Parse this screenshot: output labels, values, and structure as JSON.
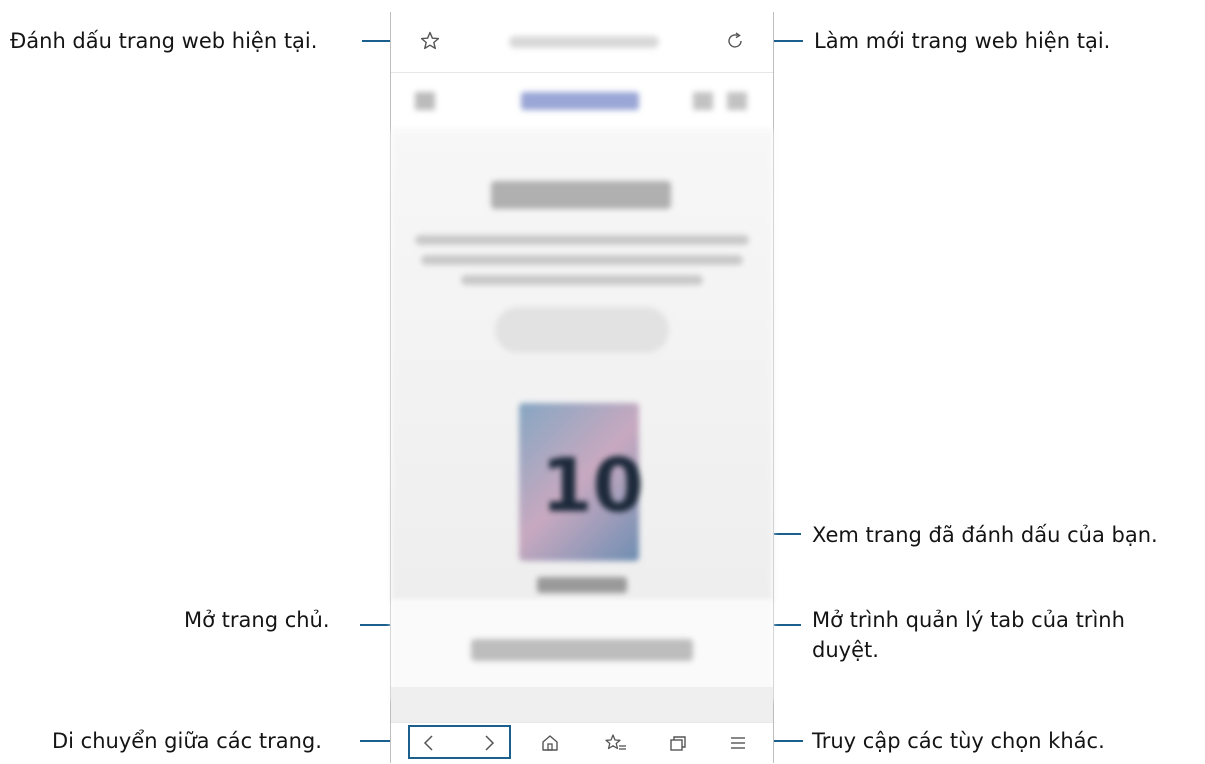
{
  "callouts": {
    "bookmark_current": "Đánh dấu trang web hiện tại.",
    "refresh_current": "Làm mới trang web hiện tại.",
    "view_bookmarks": "Xem trang đã đánh dấu của bạn.",
    "open_home": "Mở trang chủ.",
    "tab_manager": "Mở trình quản lý tab của trình duyệt.",
    "navigate_pages": "Di chuyển giữa các trang.",
    "more_options": "Truy cập các tùy chọn khác."
  },
  "browser": {
    "address_bar": {
      "bookmark_icon": "star-outline",
      "refresh_icon": "refresh"
    },
    "toolbar": {
      "back_icon": "chevron-left",
      "forward_icon": "chevron-right",
      "home_icon": "home",
      "bookmarks_icon": "star-list",
      "tabs_icon": "tabs",
      "menu_icon": "menu-lines"
    },
    "page_preview": {
      "product_number": "10"
    }
  },
  "colors": {
    "callout_line": "#1b5f8c"
  }
}
